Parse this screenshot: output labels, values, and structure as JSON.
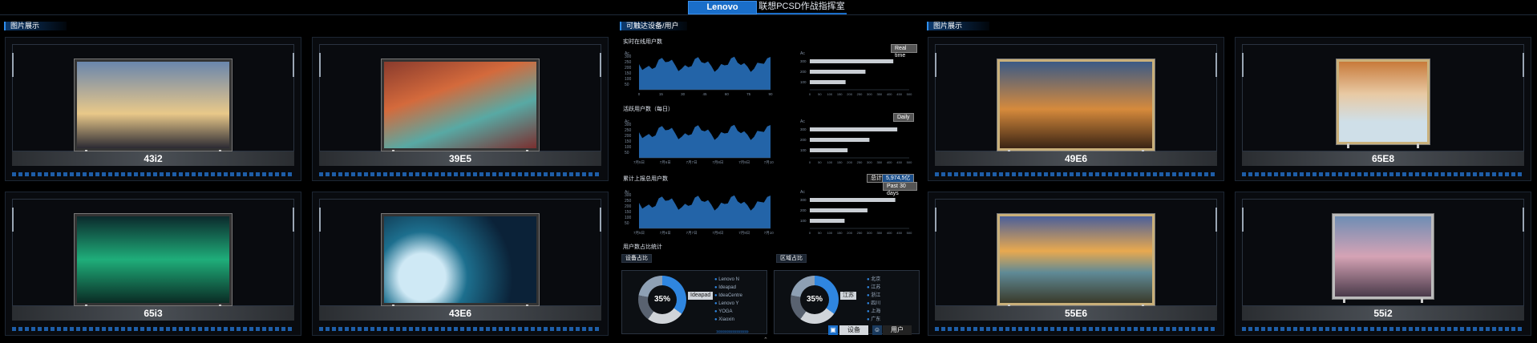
{
  "header": {
    "tab_active": "Lenovo",
    "tab_inactive": "联想PCSD作战指挥室"
  },
  "left": {
    "section_title": "图片展示",
    "products": [
      "43i2",
      "39E5",
      "65i3",
      "43E6"
    ]
  },
  "right": {
    "section_title": "图片展示",
    "products": [
      "49E6",
      "65E8",
      "55E6",
      "55i2"
    ]
  },
  "middle": {
    "section_title": "可触达设备/用户",
    "realtime": {
      "title": "实时在线用户数",
      "pill": "Real time",
      "x_ticks": [
        "0",
        "15",
        "30",
        "45",
        "60",
        "75",
        "90"
      ],
      "y_ticks": [
        "300",
        "250",
        "200",
        "150",
        "100",
        "50"
      ],
      "axis_label": "Ac",
      "bar_labels": [
        "300",
        "200",
        "100"
      ],
      "bar_values": [
        420,
        280,
        180
      ]
    },
    "daily": {
      "title": "活跃用户数（每日）",
      "pill": "Daily",
      "x_ticks": [
        "7月5日",
        "7月6日",
        "7月7日",
        "7月8日",
        "7月9日",
        "7月10日"
      ],
      "y_ticks": [
        "300",
        "250",
        "200",
        "150",
        "100",
        "50"
      ],
      "axis_label": "Ac",
      "bar_labels": [
        "300",
        "200",
        "100"
      ],
      "bar_values": [
        440,
        300,
        190
      ]
    },
    "total": {
      "title": "累计上报总用户数",
      "pill_a": "总计",
      "pill_b": "5,974,5亿",
      "pill_c": "Past 30 days",
      "x_ticks": [
        "7月5日",
        "7月6日",
        "7月7日",
        "7月8日",
        "7月9日",
        "7月10日"
      ],
      "y_ticks": [
        "300",
        "250",
        "200",
        "150",
        "100",
        "50"
      ],
      "axis_label": "Ac",
      "bar_labels": [
        "300",
        "200",
        "100"
      ],
      "bar_values": [
        430,
        290,
        175
      ]
    },
    "hbar_x_ticks": [
      "0",
      "50",
      "100",
      "150",
      "200",
      "250",
      "300",
      "350",
      "400",
      "450",
      "500"
    ],
    "share": {
      "title": "用户数占比统计",
      "device": {
        "title": "设备占比",
        "percent": "35%",
        "callout": "Ideapad",
        "legend": [
          "Lenovo N",
          "Ideapad",
          "IdeaCentre",
          "Lenovo Y",
          "YOGA",
          "Xiaoxin"
        ]
      },
      "region": {
        "title": "区域占比",
        "percent": "35%",
        "callout": "江苏",
        "legend": [
          "北京",
          "江苏",
          "浙江",
          "四川",
          "上海",
          "广东"
        ]
      }
    },
    "footer": {
      "seg1": "设备",
      "seg2": "用户"
    }
  },
  "colors": {
    "accent": "#1a6ec9",
    "bar_fill": "#2f86e0"
  }
}
